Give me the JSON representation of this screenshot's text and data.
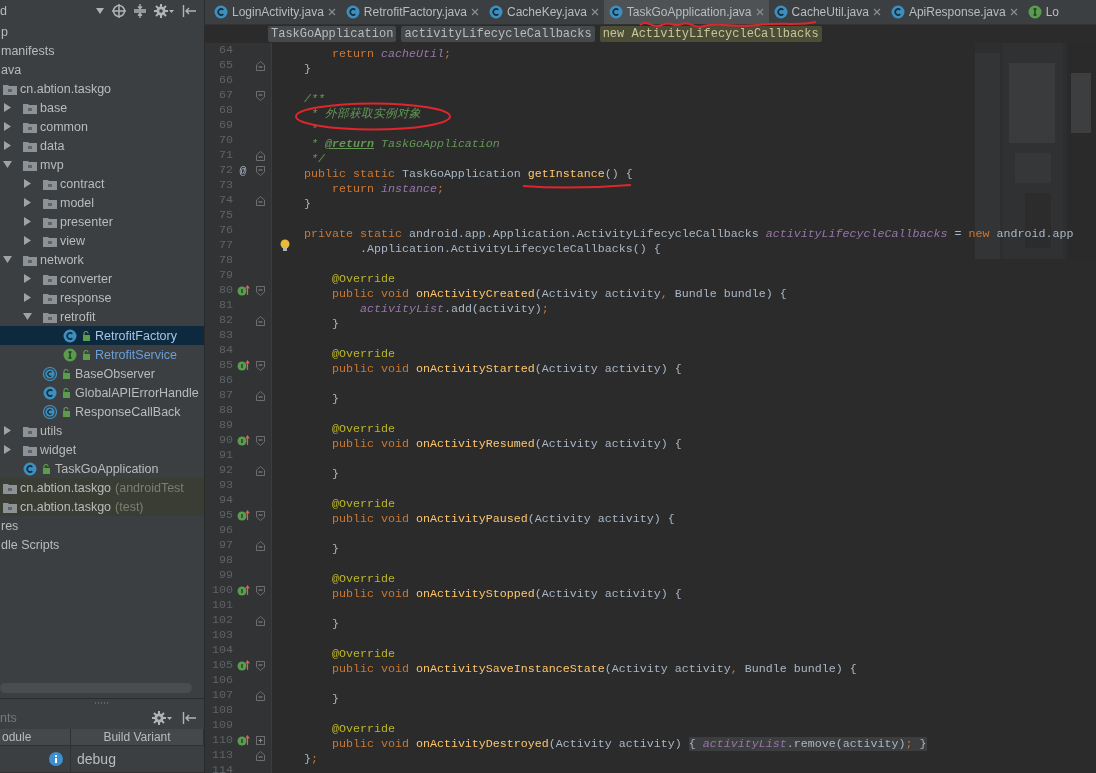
{
  "sidebar": {
    "title": "d",
    "tree": [
      {
        "label": "p",
        "selected": false
      },
      {
        "label": "manifests",
        "selected": false
      },
      {
        "label": "ava",
        "selected": false,
        "children": [
          {
            "label": "cn.abtion.taskgo",
            "kind": "package",
            "selected": false,
            "children": [
              {
                "label": "base",
                "kind": "package",
                "expanded": false,
                "selected": false
              },
              {
                "label": "common",
                "kind": "package",
                "expanded": false,
                "selected": false
              },
              {
                "label": "data",
                "kind": "package",
                "expanded": false,
                "selected": false
              },
              {
                "label": "mvp",
                "kind": "package",
                "expanded": true,
                "selected": false,
                "children": [
                  {
                    "label": "contract",
                    "kind": "package",
                    "expanded": false,
                    "selected": false
                  },
                  {
                    "label": "model",
                    "kind": "package",
                    "expanded": false,
                    "selected": false
                  },
                  {
                    "label": "presenter",
                    "kind": "package",
                    "expanded": false,
                    "selected": false
                  },
                  {
                    "label": "view",
                    "kind": "package",
                    "expanded": false,
                    "selected": false
                  }
                ]
              },
              {
                "label": "network",
                "kind": "package",
                "expanded": true,
                "selected": false,
                "children": [
                  {
                    "label": "converter",
                    "kind": "package",
                    "expanded": false,
                    "selected": false
                  },
                  {
                    "label": "response",
                    "kind": "package",
                    "expanded": false,
                    "selected": false
                  },
                  {
                    "label": "retrofit",
                    "kind": "package",
                    "expanded": true,
                    "selected": false,
                    "children": [
                      {
                        "label": "RetrofitFactory",
                        "kind": "class",
                        "modified": true,
                        "selected": true
                      },
                      {
                        "label": "RetrofitService",
                        "kind": "interface",
                        "modified": true,
                        "selected": false
                      }
                    ]
                  },
                  {
                    "label": "BaseObserver",
                    "kind": "abstract-class",
                    "selected": false
                  },
                  {
                    "label": "GlobalAPIErrorHandle",
                    "kind": "class",
                    "selected": false
                  },
                  {
                    "label": "ResponseCallBack",
                    "kind": "abstract-class",
                    "selected": false
                  }
                ]
              },
              {
                "label": "utils",
                "kind": "package",
                "expanded": false,
                "selected": false
              },
              {
                "label": "widget",
                "kind": "package",
                "expanded": false,
                "selected": false
              },
              {
                "label": "TaskGoApplication",
                "kind": "class",
                "selected": false
              }
            ]
          },
          {
            "label": "cn.abtion.taskgo",
            "suffix": "(androidTest",
            "kind": "test-package",
            "selected": false
          },
          {
            "label": "cn.abtion.taskgo",
            "suffix": "(test)",
            "kind": "test-package",
            "selected": false
          }
        ]
      },
      {
        "label": "res",
        "selected": false
      },
      {
        "label": "dle Scripts",
        "selected": false
      }
    ],
    "build_variants": {
      "title": "nts",
      "columns": [
        "odule",
        "Build Variant"
      ],
      "rows": [
        {
          "variant": "debug"
        }
      ]
    }
  },
  "tabs": [
    {
      "label": "LoginActivity.java",
      "kind": "class",
      "selected": false,
      "closable": true
    },
    {
      "label": "RetrofitFactory.java",
      "kind": "class",
      "selected": false,
      "closable": true
    },
    {
      "label": "CacheKey.java",
      "kind": "class",
      "selected": false,
      "closable": true
    },
    {
      "label": "TaskGoApplication.java",
      "kind": "class",
      "selected": true,
      "closable": true
    },
    {
      "label": "CacheUtil.java",
      "kind": "class",
      "selected": false,
      "closable": true
    },
    {
      "label": "ApiResponse.java",
      "kind": "class",
      "selected": false,
      "closable": true
    },
    {
      "label": "Lo",
      "kind": "interface",
      "selected": false,
      "closable": false
    }
  ],
  "breadcrumbs": [
    {
      "label": "TaskGoApplication",
      "selected": false
    },
    {
      "label": "activityLifecycleCallbacks",
      "selected": false
    },
    {
      "label": "new ActivityLifecycleCallbacks",
      "selected": true
    }
  ],
  "editor": {
    "lines": [
      {
        "number": "64",
        "tokens": [
          {
            "kind": "keyword",
            "text": "        return "
          },
          {
            "kind": "field",
            "text": "cacheUtil"
          },
          {
            "kind": "punct",
            "text": ";"
          }
        ]
      },
      {
        "number": "65",
        "fold": {
          "kind": "end"
        },
        "tokens": [
          {
            "kind": "plain",
            "text": "    }"
          }
        ]
      },
      {
        "number": "66"
      },
      {
        "number": "67",
        "fold": {
          "kind": "start"
        },
        "tokens": [
          {
            "kind": "doc",
            "text": "    /**"
          }
        ]
      },
      {
        "number": "68",
        "tokens": [
          {
            "kind": "doc",
            "text": "     * 外部获取实例对象"
          }
        ]
      },
      {
        "number": "69",
        "tokens": [
          {
            "kind": "doc",
            "text": "     *"
          }
        ]
      },
      {
        "number": "70",
        "tokens": [
          {
            "kind": "doc",
            "text": "     * "
          },
          {
            "kind": "doc-tag",
            "text": "@return"
          },
          {
            "kind": "doc-ref",
            "text": " TaskGoApplication"
          }
        ]
      },
      {
        "number": "71",
        "fold": {
          "kind": "end"
        },
        "tokens": [
          {
            "kind": "doc",
            "text": "     */"
          }
        ]
      },
      {
        "number": "72",
        "gutter_text": "@",
        "fold": {
          "kind": "start"
        },
        "tokens": [
          {
            "kind": "keyword",
            "text": "    public static "
          },
          {
            "kind": "plain",
            "text": "TaskGoApplication "
          },
          {
            "kind": "method",
            "text": "getInstance"
          },
          {
            "kind": "plain",
            "text": "() {"
          }
        ]
      },
      {
        "number": "73",
        "tokens": [
          {
            "kind": "keyword",
            "text": "        return "
          },
          {
            "kind": "field",
            "text": "instance"
          },
          {
            "kind": "punct",
            "text": ";"
          }
        ]
      },
      {
        "number": "74",
        "fold": {
          "kind": "end"
        },
        "tokens": [
          {
            "kind": "plain",
            "text": "    }"
          }
        ]
      },
      {
        "number": "75"
      },
      {
        "number": "76",
        "tokens": [
          {
            "kind": "keyword",
            "text": "    private static "
          },
          {
            "kind": "plain",
            "text": "android.app.Application.ActivityLifecycleCallbacks "
          },
          {
            "kind": "field",
            "text": "activityLifecycleCallbacks"
          },
          {
            "kind": "plain",
            "text": " = "
          },
          {
            "kind": "keyword",
            "text": "new "
          },
          {
            "kind": "plain",
            "text": "android.app"
          }
        ]
      },
      {
        "number": "77",
        "marker": {
          "kind": "bulb"
        },
        "tokens": [
          {
            "kind": "plain",
            "text": "            .Application.ActivityLifecycleCallbacks() {"
          }
        ]
      },
      {
        "number": "78"
      },
      {
        "number": "79",
        "tokens": [
          {
            "kind": "annotation",
            "text": "        @Override"
          }
        ]
      },
      {
        "number": "80",
        "marker": {
          "kind": "override"
        },
        "fold": {
          "kind": "start"
        },
        "tokens": [
          {
            "kind": "keyword",
            "text": "        public void "
          },
          {
            "kind": "method",
            "text": "onActivityCreated"
          },
          {
            "kind": "plain",
            "text": "(Activity activity"
          },
          {
            "kind": "punct",
            "text": ", "
          },
          {
            "kind": "plain",
            "text": "Bundle bundle) {"
          }
        ]
      },
      {
        "number": "81",
        "tokens": [
          {
            "kind": "field",
            "text": "            activityList"
          },
          {
            "kind": "plain",
            "text": ".add(activity)"
          },
          {
            "kind": "punct",
            "text": ";"
          }
        ]
      },
      {
        "number": "82",
        "fold": {
          "kind": "end"
        },
        "tokens": [
          {
            "kind": "plain",
            "text": "        }"
          }
        ]
      },
      {
        "number": "83"
      },
      {
        "number": "84",
        "tokens": [
          {
            "kind": "annotation",
            "text": "        @Override"
          }
        ]
      },
      {
        "number": "85",
        "marker": {
          "kind": "override"
        },
        "fold": {
          "kind": "start"
        },
        "tokens": [
          {
            "kind": "keyword",
            "text": "        public void "
          },
          {
            "kind": "method",
            "text": "onActivityStarted"
          },
          {
            "kind": "plain",
            "text": "(Activity activity) {"
          }
        ]
      },
      {
        "number": "86"
      },
      {
        "number": "87",
        "fold": {
          "kind": "end"
        },
        "tokens": [
          {
            "kind": "plain",
            "text": "        }"
          }
        ]
      },
      {
        "number": "88"
      },
      {
        "number": "89",
        "tokens": [
          {
            "kind": "annotation",
            "text": "        @Override"
          }
        ]
      },
      {
        "number": "90",
        "marker": {
          "kind": "override"
        },
        "fold": {
          "kind": "start"
        },
        "tokens": [
          {
            "kind": "keyword",
            "text": "        public void "
          },
          {
            "kind": "method",
            "text": "onActivityResumed"
          },
          {
            "kind": "plain",
            "text": "(Activity activity) {"
          }
        ]
      },
      {
        "number": "91"
      },
      {
        "number": "92",
        "fold": {
          "kind": "end"
        },
        "tokens": [
          {
            "kind": "plain",
            "text": "        }"
          }
        ]
      },
      {
        "number": "93"
      },
      {
        "number": "94",
        "tokens": [
          {
            "kind": "annotation",
            "text": "        @Override"
          }
        ]
      },
      {
        "number": "95",
        "marker": {
          "kind": "override"
        },
        "fold": {
          "kind": "start"
        },
        "tokens": [
          {
            "kind": "keyword",
            "text": "        public void "
          },
          {
            "kind": "method",
            "text": "onActivityPaused"
          },
          {
            "kind": "plain",
            "text": "(Activity activity) {"
          }
        ]
      },
      {
        "number": "96"
      },
      {
        "number": "97",
        "fold": {
          "kind": "end"
        },
        "tokens": [
          {
            "kind": "plain",
            "text": "        }"
          }
        ]
      },
      {
        "number": "98"
      },
      {
        "number": "99",
        "tokens": [
          {
            "kind": "annotation",
            "text": "        @Override"
          }
        ]
      },
      {
        "number": "100",
        "marker": {
          "kind": "override"
        },
        "fold": {
          "kind": "start"
        },
        "tokens": [
          {
            "kind": "keyword",
            "text": "        public void "
          },
          {
            "kind": "method",
            "text": "onActivityStopped"
          },
          {
            "kind": "plain",
            "text": "(Activity activity) {"
          }
        ]
      },
      {
        "number": "101"
      },
      {
        "number": "102",
        "fold": {
          "kind": "end"
        },
        "tokens": [
          {
            "kind": "plain",
            "text": "        }"
          }
        ]
      },
      {
        "number": "103"
      },
      {
        "number": "104",
        "tokens": [
          {
            "kind": "annotation",
            "text": "        @Override"
          }
        ]
      },
      {
        "number": "105",
        "marker": {
          "kind": "override"
        },
        "fold": {
          "kind": "start"
        },
        "tokens": [
          {
            "kind": "keyword",
            "text": "        public void "
          },
          {
            "kind": "method",
            "text": "onActivitySaveInstanceState"
          },
          {
            "kind": "plain",
            "text": "(Activity activity"
          },
          {
            "kind": "punct",
            "text": ", "
          },
          {
            "kind": "plain",
            "text": "Bundle bundle) {"
          }
        ]
      },
      {
        "number": "106"
      },
      {
        "number": "107",
        "fold": {
          "kind": "end"
        },
        "tokens": [
          {
            "kind": "plain",
            "text": "        }"
          }
        ]
      },
      {
        "number": "108"
      },
      {
        "number": "109",
        "tokens": [
          {
            "kind": "annotation",
            "text": "        @Override"
          }
        ]
      },
      {
        "number": "110",
        "marker": {
          "kind": "override"
        },
        "fold": {
          "kind": "collapsed"
        },
        "tokens": [
          {
            "kind": "keyword",
            "text": "        public void "
          },
          {
            "kind": "method",
            "text": "onActivityDestroyed"
          },
          {
            "kind": "plain",
            "text": "(Activity activity) "
          },
          {
            "kind": "plain",
            "text": "{ ",
            "folded": true
          },
          {
            "kind": "field",
            "text": "activityList",
            "folded": true
          },
          {
            "kind": "plain",
            "text": ".remove(activity)",
            "folded": true
          },
          {
            "kind": "punct",
            "text": ";",
            "folded": true
          },
          {
            "kind": "plain",
            "text": " }",
            "folded": true
          }
        ]
      },
      {
        "number": "113",
        "fold": {
          "kind": "end"
        },
        "tokens": [
          {
            "kind": "plain",
            "text": "    }"
          },
          {
            "kind": "punct",
            "text": ";"
          }
        ]
      },
      {
        "number": "114"
      }
    ]
  },
  "annotations": [
    {
      "kind": "circle"
    },
    {
      "kind": "underline"
    },
    {
      "kind": "scribble"
    }
  ]
}
